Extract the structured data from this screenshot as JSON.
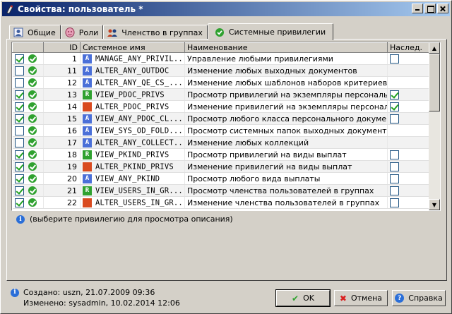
{
  "window": {
    "title": "Свойства: пользователь *"
  },
  "tabs": [
    {
      "label": "Общие",
      "icon": "user-icon"
    },
    {
      "label": "Роли",
      "icon": "roles-icon"
    },
    {
      "label": "Членство в группах",
      "icon": "group-icon"
    },
    {
      "label": "Системные привилегии",
      "icon": "privilege-check-icon",
      "active": true
    }
  ],
  "table": {
    "columns": [
      "",
      "ID",
      "Системное имя",
      "Наименование",
      "Наслед."
    ],
    "rows": [
      {
        "checked": true,
        "id": "1",
        "type": "A",
        "sysname": "MANAGE_ANY_PRIVIL...",
        "name": "Управление любыми привилегиями",
        "inherit": "empty"
      },
      {
        "checked": false,
        "id": "11",
        "type": "A",
        "sysname": "ALTER_ANY_OUTDOC",
        "name": "Изменение любых выходных документов",
        "inherit": "none"
      },
      {
        "checked": false,
        "id": "12",
        "type": "A",
        "sysname": "ALTER_ANY_QE_CS_...",
        "name": "Изменение любых шаблонов наборов критериев МПЗ",
        "inherit": "none"
      },
      {
        "checked": true,
        "id": "13",
        "type": "R",
        "sysname": "VIEW_PDOC_PRIVS",
        "name": "Просмотр привилегий на экземпляры персональных...",
        "inherit": "checked"
      },
      {
        "checked": true,
        "id": "14",
        "type": "W",
        "sysname": "ALTER_PDOC_PRIVS",
        "name": "Изменение привилегий на экземпляры персональны...",
        "inherit": "checked"
      },
      {
        "checked": true,
        "id": "15",
        "type": "A",
        "sysname": "VIEW_ANY_PDOC_CL...",
        "name": "Просмотр любого класса персонального документа",
        "inherit": "empty"
      },
      {
        "checked": false,
        "id": "16",
        "type": "A",
        "sysname": "VIEW_SYS_OD_FOLD...",
        "name": "Просмотр системных папок выходных документов",
        "inherit": "none"
      },
      {
        "checked": false,
        "id": "17",
        "type": "A",
        "sysname": "ALTER_ANY_COLLECT...",
        "name": "Изменение любых коллекций",
        "inherit": "none"
      },
      {
        "checked": true,
        "id": "18",
        "type": "R",
        "sysname": "VIEW_PKIND_PRIVS",
        "name": "Просмотр привилегий на виды выплат",
        "inherit": "empty"
      },
      {
        "checked": true,
        "id": "19",
        "type": "W",
        "sysname": "ALTER_PKIND_PRIVS",
        "name": "Изменение привилегий на виды выплат",
        "inherit": "empty"
      },
      {
        "checked": true,
        "id": "20",
        "type": "A",
        "sysname": "VIEW_ANY_PKIND",
        "name": "Просмотр любого вида выплаты",
        "inherit": "empty"
      },
      {
        "checked": true,
        "id": "21",
        "type": "R",
        "sysname": "VIEW_USERS_IN_GR...",
        "name": "Просмотр членства пользователей в группах",
        "inherit": "empty"
      },
      {
        "checked": true,
        "id": "22",
        "type": "W",
        "sysname": "ALTER_USERS_IN_GR...",
        "name": "Изменение членства пользователей в группах",
        "inherit": "empty"
      }
    ]
  },
  "description": {
    "text": "(выберите привилегию для просмотра описания)"
  },
  "footer": {
    "created": "Создано: uszn, 21.07.2009 09:36",
    "modified": "Изменено: sysadmin, 10.02.2014 12:06"
  },
  "buttons": {
    "ok": "OK",
    "cancel": "Отмена",
    "help": "Справка"
  }
}
